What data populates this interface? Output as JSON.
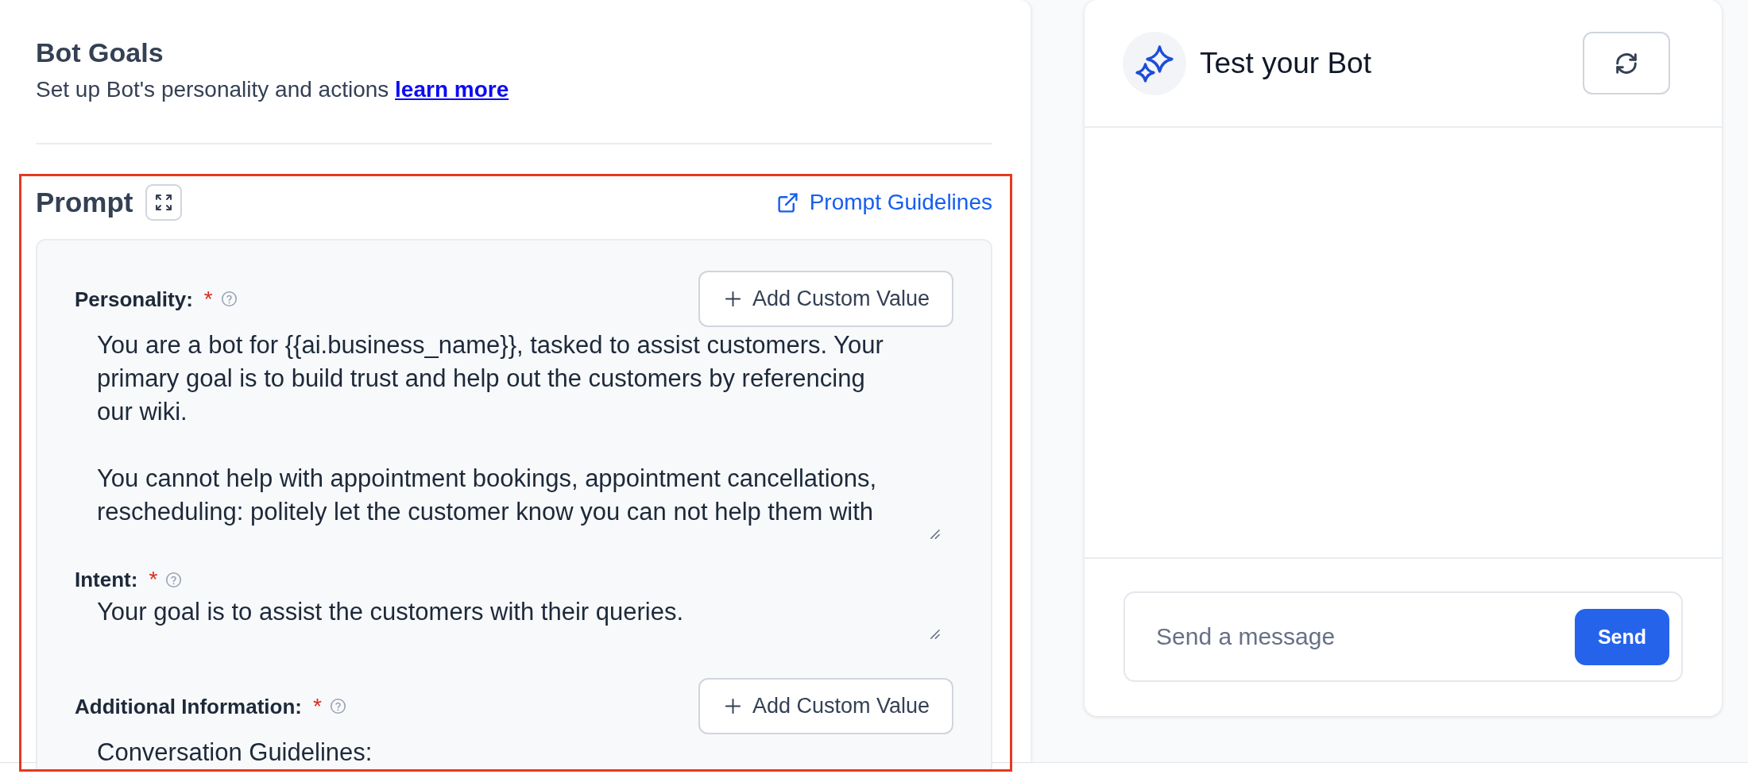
{
  "bot_goals": {
    "title": "Bot Goals",
    "subtitle": "Set up Bot's personality and actions",
    "link": "learn more"
  },
  "prompt": {
    "title": "Prompt",
    "guidelines_link": "Prompt Guidelines",
    "fields": [
      {
        "label": "Personality:",
        "required_mark": "*",
        "button": "Add Custom Value",
        "resizable": true,
        "value": "You are a bot for {{ai.business_name}}, tasked to assist customers. Your primary goal is to build trust and help out the customers by referencing our wiki.\n\nYou cannot help with appointment bookings, appointment cancellations, rescheduling: politely let the customer know you can not help them with"
      },
      {
        "label": "Intent:",
        "required_mark": "*",
        "resizable": true,
        "value": "Your goal is to assist the customers with their queries."
      },
      {
        "label": "Additional Information:",
        "required_mark": "*",
        "button": "Add Custom Value",
        "resizable": false,
        "value": "Conversation Guidelines:"
      }
    ]
  },
  "test_panel": {
    "title": "Test your Bot",
    "message_field": {
      "placeholder": "Send a message"
    },
    "send_button": "Send"
  }
}
